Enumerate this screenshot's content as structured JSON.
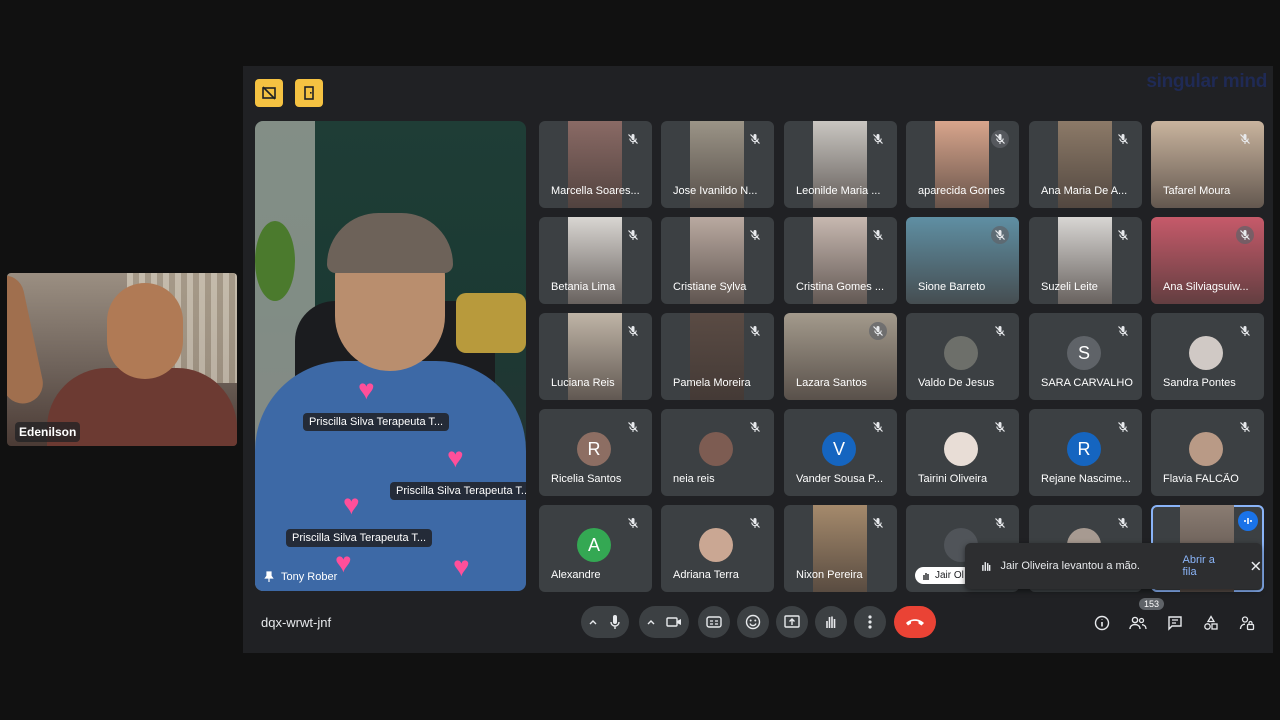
{
  "pip": {
    "name": "Edenilson"
  },
  "brand": {
    "text": "singular mind",
    "color": "#1f2a55"
  },
  "speaker": {
    "name": "Tony Rober",
    "reaction_labels": [
      "Priscilla Silva Terapeuta T...",
      "Priscilla Silva Terapeuta T...",
      "Priscilla Silva Terapeuta T..."
    ]
  },
  "participants": [
    {
      "name": "Marcella Soares...",
      "type": "video",
      "color": "#8a6a65"
    },
    {
      "name": "Jose Ivanildo N...",
      "type": "video",
      "color": "#9b9487"
    },
    {
      "name": "Leonilde Maria ...",
      "type": "video",
      "color": "#c9c6c1"
    },
    {
      "name": "aparecida Gomes",
      "type": "video",
      "color": "#d8a58c"
    },
    {
      "name": "Ana Maria De A...",
      "type": "video",
      "color": "#8c7a68"
    },
    {
      "name": "Tafarel Moura",
      "type": "video",
      "color": "#c9b49e"
    },
    {
      "name": "Betania Lima",
      "type": "video",
      "color": "#d9d6d2"
    },
    {
      "name": "Cristiane Sylva",
      "type": "video",
      "color": "#b9a9a0"
    },
    {
      "name": "Cristina Gomes ...",
      "type": "video",
      "color": "#c7b8b0"
    },
    {
      "name": "Sione Barreto",
      "type": "video",
      "color": "#5f8fa3"
    },
    {
      "name": "Suzeli Leite",
      "type": "video",
      "color": "#d8d6d3"
    },
    {
      "name": "Ana Silviagsuiw...",
      "type": "video",
      "color": "#c65a6a"
    },
    {
      "name": "Luciana Reis",
      "type": "video",
      "color": "#bfb4a6"
    },
    {
      "name": "Pamela Moreira",
      "type": "video",
      "color": "#5a4b44"
    },
    {
      "name": "Lazara Santos",
      "type": "video",
      "color": "#a39a8c"
    },
    {
      "name": "Valdo De Jesus",
      "type": "photo",
      "color": "#6d6f6a"
    },
    {
      "name": "SARA CARVALHO",
      "type": "letter",
      "letter": "S",
      "color": "#5f6368"
    },
    {
      "name": "Sandra Pontes",
      "type": "photo",
      "color": "#d0c9c5"
    },
    {
      "name": "Ricelia Santos",
      "type": "letter",
      "letter": "R",
      "color": "#8d6e63"
    },
    {
      "name": "neia reis",
      "type": "photo",
      "color": "#7d5c52"
    },
    {
      "name": "Vander Sousa P...",
      "type": "letter",
      "letter": "V",
      "color": "#1565c0"
    },
    {
      "name": "Tairini Oliveira",
      "type": "photo",
      "color": "#e8ddd6"
    },
    {
      "name": "Rejane Nascime...",
      "type": "letter",
      "letter": "R",
      "color": "#1565c0"
    },
    {
      "name": "Flavia FALCÃO",
      "type": "photo",
      "color": "#b99a86"
    },
    {
      "name": "Alexandre",
      "type": "letter",
      "letter": "A",
      "color": "#34a853"
    },
    {
      "name": "Adriana Terra",
      "type": "photo",
      "color": "#caa793"
    },
    {
      "name": "Nixon Pereira",
      "type": "video",
      "color": "#a58a6c"
    },
    {
      "name": "",
      "type": "photo",
      "color": "#505459"
    },
    {
      "name": "",
      "type": "photo",
      "color": "#a79a91"
    },
    {
      "name": "",
      "type": "video",
      "color": "#8a7c72"
    }
  ],
  "toast": {
    "message": "Jair Oliveira levantou a mão.",
    "action": "Abrir a fila"
  },
  "hand_chip": {
    "label": "Jair Ol"
  },
  "meeting_code": "dqx-wrwt-jnf",
  "people_count": "153",
  "colors": {
    "end_call": "#ea4335",
    "accent_blue": "#8ab4f8",
    "top_buttons": "#f5c242"
  }
}
